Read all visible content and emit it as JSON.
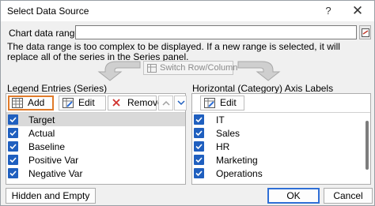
{
  "window": {
    "title": "Select Data Source",
    "help": "?",
    "close": "✕"
  },
  "range": {
    "label": "Chart data range:",
    "value": ""
  },
  "info": {
    "message": "The data range is too complex to be displayed. If a new range is selected, it will replace all of the series in the Series panel."
  },
  "switch_button": {
    "label": "Switch Row/Column",
    "enabled": false
  },
  "legend": {
    "header": "Legend Entries (Series)",
    "add": "Add",
    "edit": "Edit",
    "remove": "Remove",
    "items": [
      {
        "label": "Target",
        "checked": true,
        "selected": true
      },
      {
        "label": "Actual",
        "checked": true,
        "selected": false
      },
      {
        "label": "Baseline",
        "checked": true,
        "selected": false
      },
      {
        "label": "Positive Var",
        "checked": true,
        "selected": false
      },
      {
        "label": "Negative Var",
        "checked": true,
        "selected": false
      }
    ]
  },
  "axis": {
    "header": "Horizontal (Category) Axis Labels",
    "edit": "Edit",
    "items": [
      {
        "label": "IT",
        "checked": true
      },
      {
        "label": "Sales",
        "checked": true
      },
      {
        "label": "HR",
        "checked": true
      },
      {
        "label": "Marketing",
        "checked": true
      },
      {
        "label": "Operations",
        "checked": true
      }
    ]
  },
  "footer": {
    "hidden_cells": "Hidden and Empty Cells",
    "ok": "OK",
    "cancel": "Cancel"
  },
  "colors": {
    "checkbox": "#1f5fbf",
    "highlight": "#e07b2a",
    "ok_border": "#2f6fd6"
  }
}
